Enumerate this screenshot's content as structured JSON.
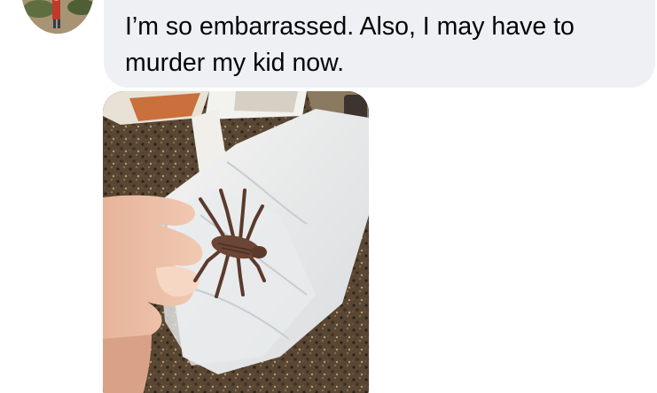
{
  "message": {
    "text": "I’m so embarrassed. Also, I may have to\nmurder my kid now."
  },
  "photo": {
    "subject": "plastic toy spider held in hand over granite countertop"
  },
  "colors": {
    "bubble": "#eef0f3",
    "text": "#050505",
    "background": "#ffffff"
  }
}
